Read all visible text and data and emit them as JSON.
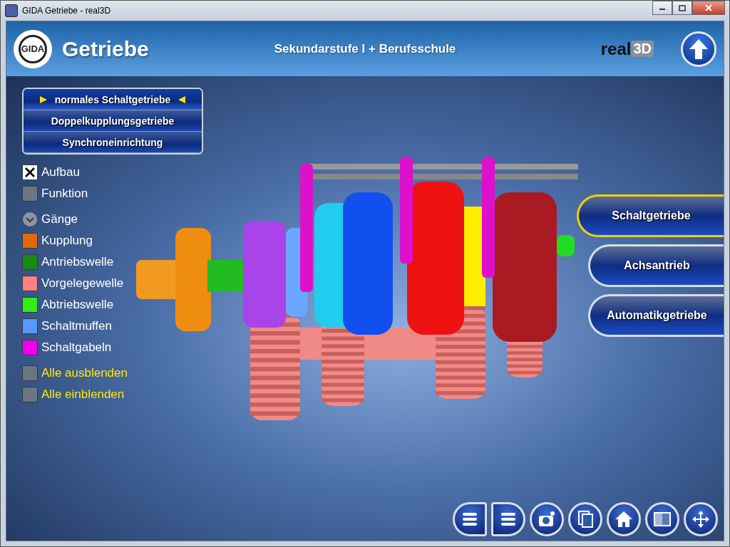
{
  "window": {
    "title": "GIDA  Getriebe - real3D"
  },
  "header": {
    "logo": "GIDA",
    "title": "Getriebe",
    "subtitle": "Sekundarstufe I + Berufsschule",
    "brand": "real",
    "brand_3d": "3D"
  },
  "modes": [
    {
      "label": "normales Schaltgetriebe",
      "selected": true
    },
    {
      "label": "Doppelkupplungsgetriebe",
      "selected": false
    },
    {
      "label": "Synchroneinrichtung",
      "selected": false
    }
  ],
  "view_options": [
    {
      "label": "Aufbau",
      "checked": true
    },
    {
      "label": "Funktion",
      "checked": false
    }
  ],
  "gears": {
    "label": "Gänge"
  },
  "components": [
    {
      "label": "Kupplung",
      "color": "#e06a00"
    },
    {
      "label": "Antriebswelle",
      "color": "#1a8a14"
    },
    {
      "label": "Vorgelegewelle",
      "color": "#ff8080"
    },
    {
      "label": "Abtriebswelle",
      "color": "#33ee11"
    },
    {
      "label": "Schaltmuffen",
      "color": "#5599ff"
    },
    {
      "label": "Schaltgabeln",
      "color": "#ee00ee"
    }
  ],
  "visibility": [
    {
      "label": "Alle ausblenden",
      "checked": false
    },
    {
      "label": "Alle einblenden",
      "checked": false
    }
  ],
  "categories": [
    {
      "label": "Schaltgetriebe",
      "selected": true
    },
    {
      "label": "Achsantrieb",
      "selected": false
    },
    {
      "label": "Automatikgetriebe",
      "selected": false
    }
  ]
}
